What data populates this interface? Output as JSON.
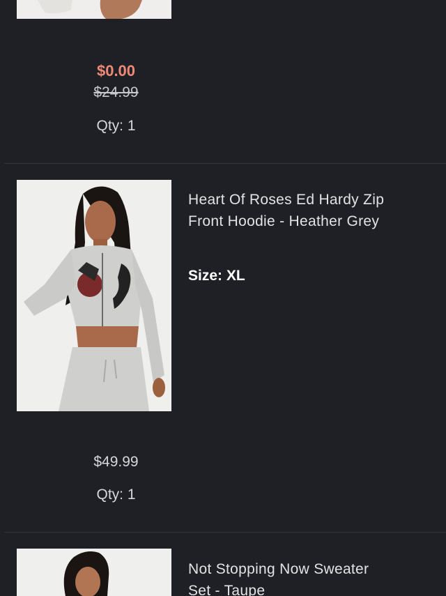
{
  "colors": {
    "background": "#1f2025",
    "sale_price": "#f08a78",
    "divider": "#34353b",
    "text": "#e3e3e6"
  },
  "items": [
    {
      "sale_price": "$0.00",
      "original_price": "$24.99",
      "qty_text": "Qty: 1"
    },
    {
      "title": "Heart Of Roses Ed Hardy Zip Front Hoodie - Heather Grey",
      "size_label": "Size:",
      "size_value": "XL",
      "price": "$49.99",
      "qty_text": "Qty: 1"
    },
    {
      "title": "Not Stopping Now Sweater Set - Taupe"
    }
  ]
}
